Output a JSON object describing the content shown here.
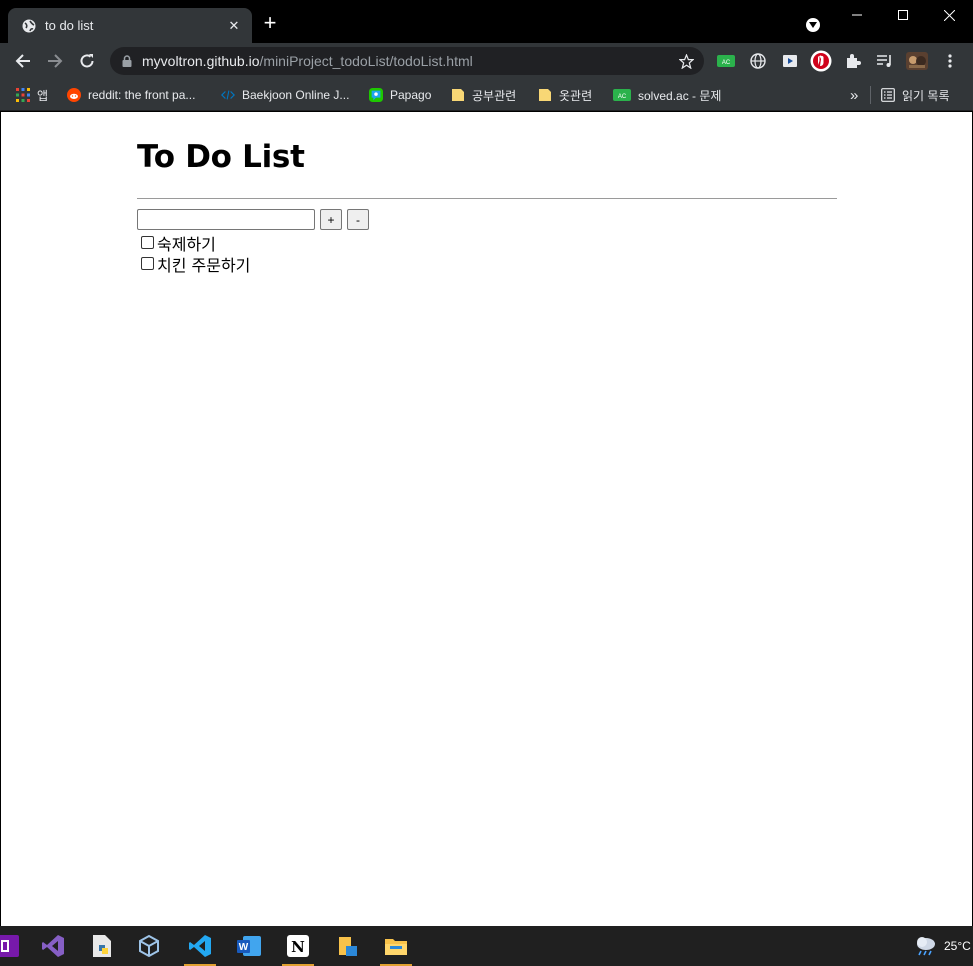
{
  "browser": {
    "tab_title": "to do list",
    "url_host": "myvoltron.github.io",
    "url_path": "/miniProject_todoList/todoList.html",
    "bookmarks": [
      {
        "label": "앱",
        "icon": "apps-grid-icon"
      },
      {
        "label": "reddit: the front pa...",
        "icon": "reddit-icon"
      },
      {
        "label": "Baekjoon Online J...",
        "icon": "code-icon"
      },
      {
        "label": "Papago",
        "icon": "papago-icon"
      },
      {
        "label": "공부관련",
        "icon": "folder-icon"
      },
      {
        "label": "옷관련",
        "icon": "folder-icon"
      },
      {
        "label": "solved.ac - 문제",
        "icon": "solvedac-icon"
      }
    ],
    "overflow_label": "»",
    "reading_list_label": "읽기 목록"
  },
  "page": {
    "title": "To Do List",
    "input_value": "",
    "add_label": "+",
    "remove_label": "-",
    "todos": [
      {
        "text": "숙제하기",
        "checked": false
      },
      {
        "text": "치킨 주문하기",
        "checked": false
      }
    ]
  },
  "taskbar": {
    "weather_temp": "25°C"
  },
  "colors": {
    "chrome_dark": "#323639",
    "titlebar": "#000000",
    "taskbar": "#202020"
  }
}
